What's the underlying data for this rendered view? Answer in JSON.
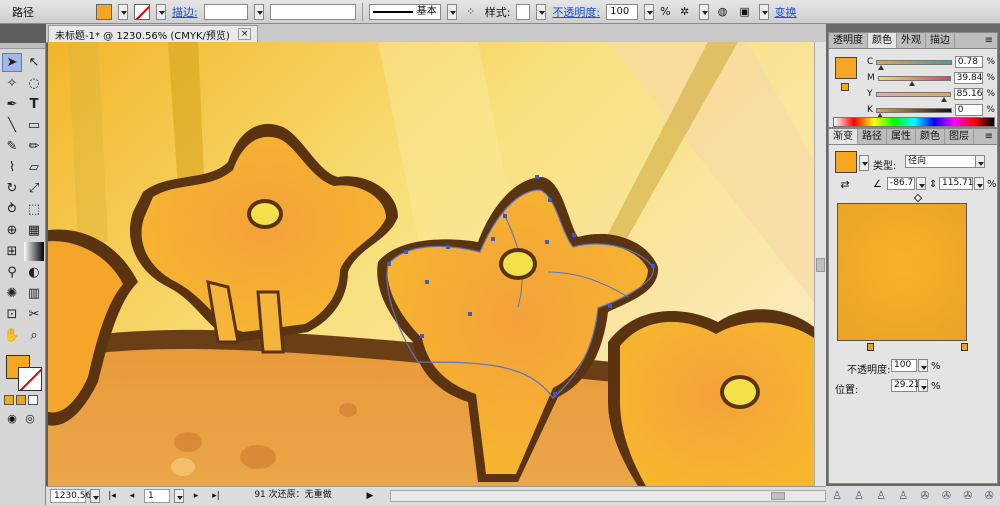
{
  "control_bar": {
    "object_type": "路径",
    "stroke_label": "描边:",
    "stroke_profile": "基本",
    "style_label": "样式:",
    "opacity_label": "不透明度:",
    "opacity_value": "100",
    "opacity_unit": "%",
    "transform_label": "变换",
    "fill_color": "#f5a623"
  },
  "document": {
    "tab_title": "未标题-1* @ 1230.56% (CMYK/预览)",
    "close_glyph": "×"
  },
  "status_bar": {
    "zoom": "1230.56",
    "page": "1",
    "info": "91 次还原：无重做"
  },
  "color_panel": {
    "tabs": [
      "透明度",
      "颜色",
      "外观",
      "描边"
    ],
    "active_tab": 1,
    "channels": [
      {
        "label": "C",
        "value": "0.78",
        "level": 0.0078
      },
      {
        "label": "M",
        "value": "39.84",
        "level": 0.3984
      },
      {
        "label": "Y",
        "value": "85.16",
        "level": 0.8516
      },
      {
        "label": "K",
        "value": "0",
        "level": 0
      }
    ],
    "unit": "%",
    "swatch_color": "#f5a623"
  },
  "gradient_panel": {
    "tabs": [
      "渐变",
      "路径",
      "属性",
      "颜色",
      "图层"
    ],
    "active_tab": 0,
    "type_label": "类型:",
    "type_value": "径向",
    "angle_value": "-86.7",
    "aspect_value": "115.71",
    "aspect_unit": "%",
    "opacity_label": "不透明度:",
    "opacity_value": "100",
    "opacity_unit": "%",
    "location_label": "位置:",
    "location_value": "29.21",
    "location_unit": "%",
    "color_start": "#f9b12a",
    "color_end": "#e8a326"
  }
}
